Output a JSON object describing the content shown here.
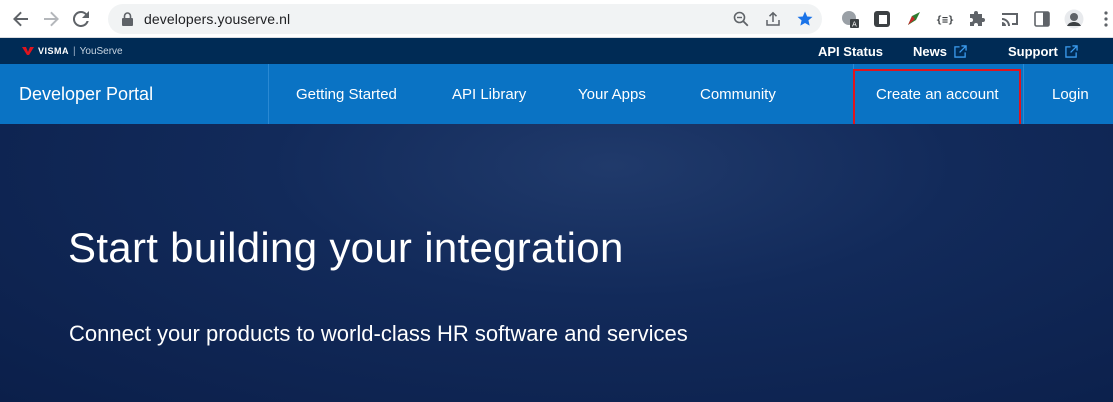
{
  "browser": {
    "url": "developers.youserve.nl"
  },
  "topbar": {
    "brand_logo": "VISMA",
    "brand_separator": "|",
    "brand_product": "YouServe",
    "links": {
      "api_status": "API Status",
      "news": "News",
      "support": "Support"
    }
  },
  "nav": {
    "title": "Developer Portal",
    "items": {
      "getting_started": "Getting Started",
      "api_library": "API Library",
      "your_apps": "Your Apps",
      "community": "Community",
      "create_account": "Create an account",
      "login": "Login"
    }
  },
  "hero": {
    "title": "Start building your integration",
    "subtitle": "Connect your products to world-class HR software and services"
  },
  "colors": {
    "nav_blue": "#0a73c4",
    "top_strip": "#002b55",
    "hero_bg": "#0b1f4a",
    "highlight": "#e0141e",
    "bookmark_star": "#1a73e8"
  }
}
